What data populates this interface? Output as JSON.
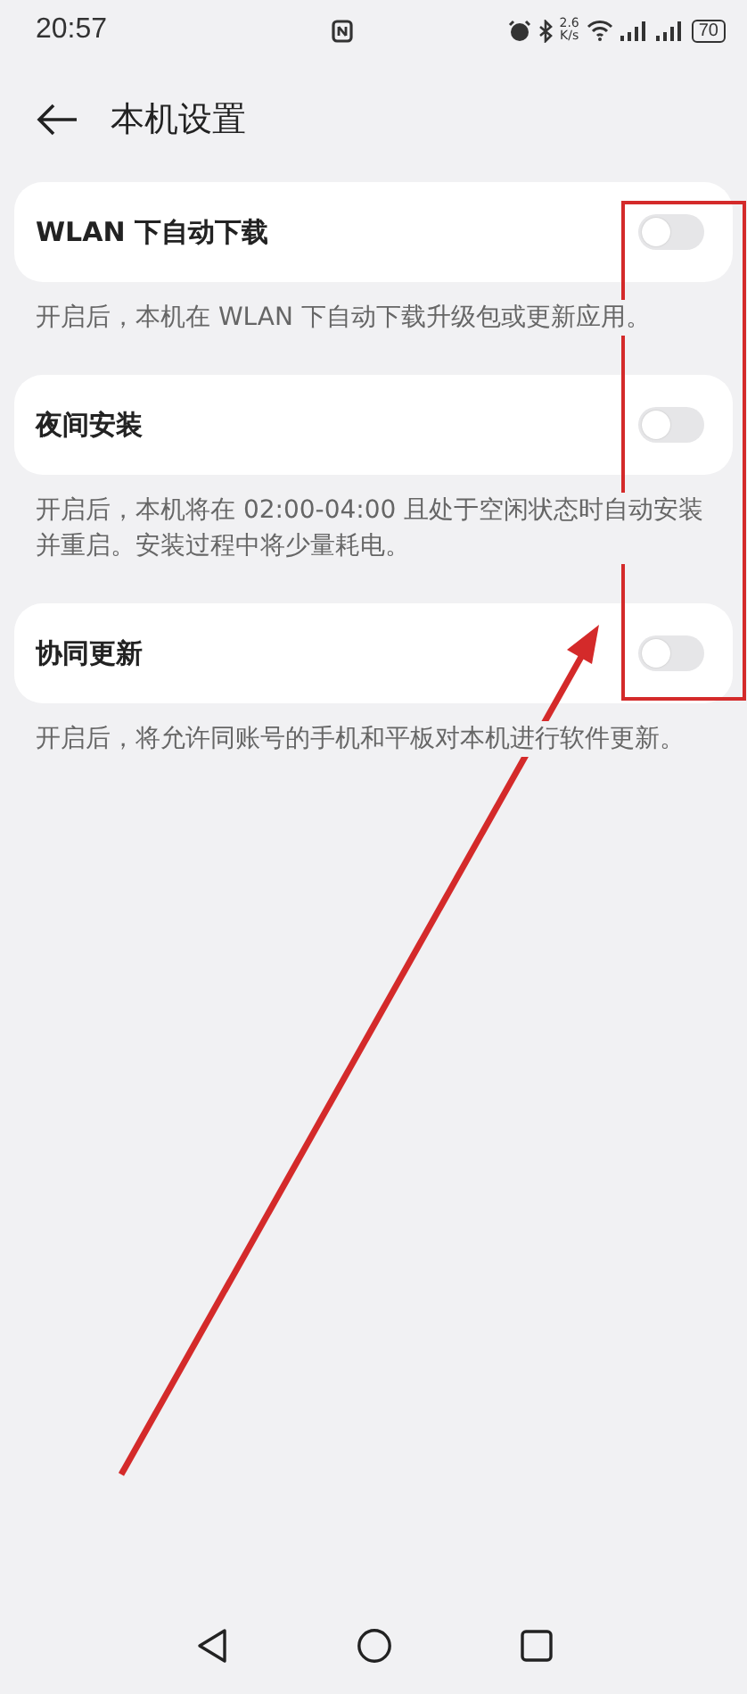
{
  "status_bar": {
    "time": "20:57",
    "net_speed_value": "2.6",
    "net_speed_unit": "K/s",
    "battery": "70"
  },
  "header": {
    "title": "本机设置"
  },
  "settings": [
    {
      "title": "WLAN 下自动下载",
      "on": false,
      "description": "开启后，本机在 WLAN 下自动下载升级包或更新应用。"
    },
    {
      "title": "夜间安装",
      "on": false,
      "description": "开启后，本机将在 02:00-04:00 且处于空闲状态时自动安装并重启。安装过程中将少量耗电。"
    },
    {
      "title": "协同更新",
      "on": false,
      "description": "开启后，将允许同账号的手机和平板对本机进行软件更新。"
    }
  ]
}
